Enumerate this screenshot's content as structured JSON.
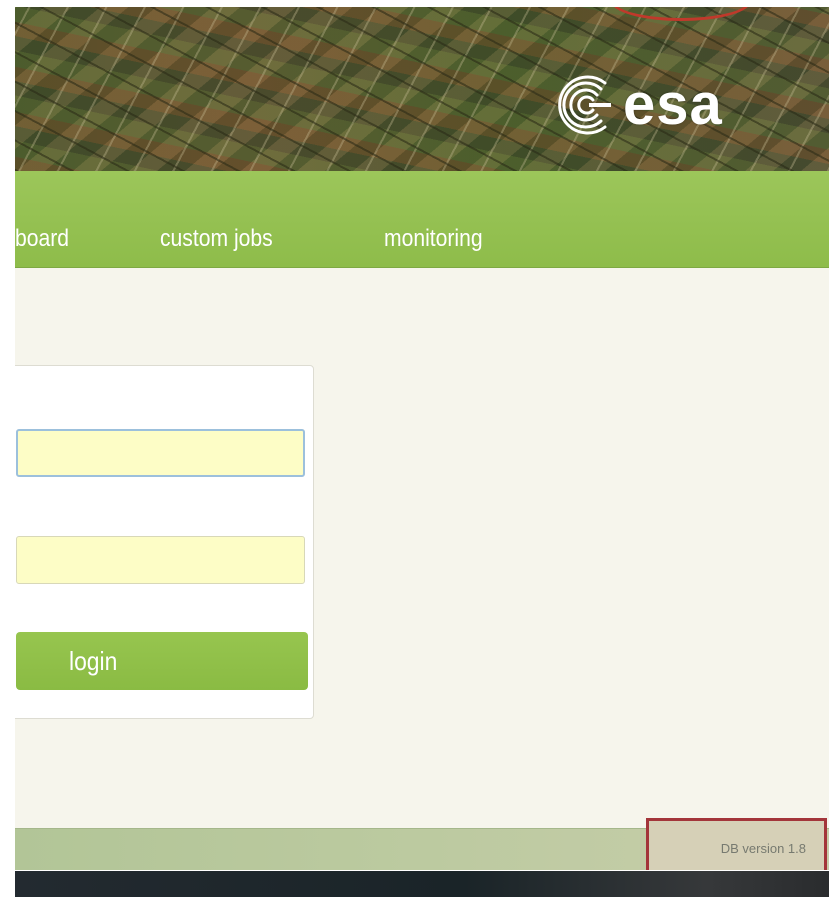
{
  "header": {
    "brand": "esa",
    "logo_icon": "esa-logo-icon"
  },
  "nav": {
    "items": [
      {
        "label": "board",
        "name": "dashboard"
      },
      {
        "label": "custom jobs",
        "name": "custom-jobs"
      },
      {
        "label": "monitoring",
        "name": "monitoring"
      }
    ]
  },
  "login": {
    "username_value": "",
    "password_value": "",
    "button_label": "login"
  },
  "footer": {
    "db_version": "DB version 1.8"
  },
  "colors": {
    "nav_green": "#8ebc4a",
    "button_green": "#8abb43",
    "input_fill": "#fdfdc6",
    "page_background": "#f6f5ec",
    "highlight_red": "#a3353a"
  }
}
